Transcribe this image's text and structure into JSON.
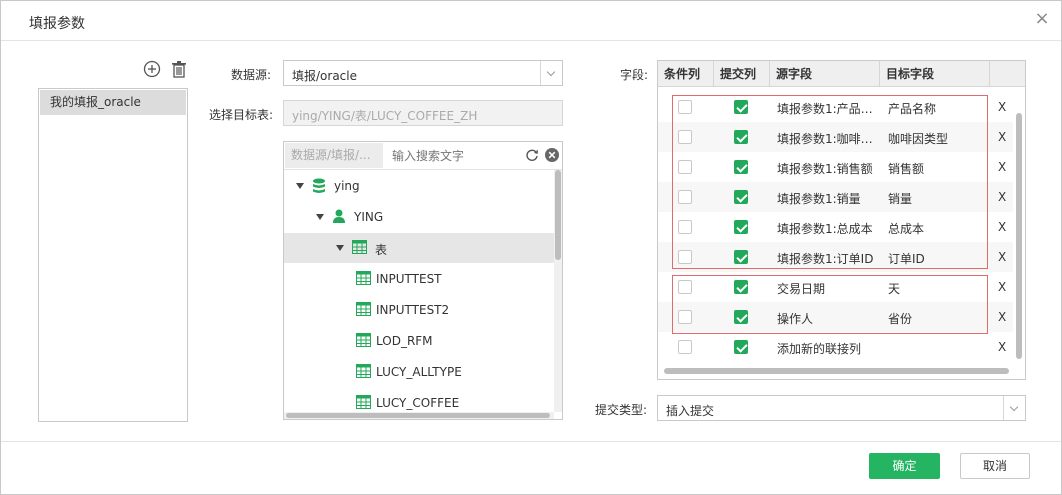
{
  "dialog": {
    "title": "填报参数",
    "close_label": "×"
  },
  "left": {
    "items": [
      {
        "label": "我的填报_oracle"
      }
    ]
  },
  "form": {
    "datasource_label": "数据源:",
    "datasource_value": "填报/oracle",
    "target_label": "选择目标表:",
    "target_value": "ying/YING/表/LUCY_COFFEE_ZH",
    "source_chip": "数据源/填报/...",
    "search_placeholder": "输入搜索文字"
  },
  "tree": {
    "nodes": [
      {
        "label": "ying",
        "icon": "database-icon"
      },
      {
        "label": "YING",
        "icon": "user-icon"
      },
      {
        "label": "表",
        "icon": "table-icon"
      },
      {
        "label": "INPUTTEST",
        "icon": "table-icon"
      },
      {
        "label": "INPUTTEST2",
        "icon": "table-icon"
      },
      {
        "label": "LOD_RFM",
        "icon": "table-icon"
      },
      {
        "label": "LUCY_ALLTYPE",
        "icon": "table-icon"
      },
      {
        "label": "LUCY_COFFEE",
        "icon": "table-icon"
      }
    ]
  },
  "fields": {
    "label": "字段:",
    "columns": [
      "条件列",
      "提交列",
      "源字段",
      "目标字段"
    ],
    "rows": [
      {
        "condition": false,
        "submit": true,
        "source": "填报参数1:产品…",
        "target": "产品名称",
        "remove": "X"
      },
      {
        "condition": false,
        "submit": true,
        "source": "填报参数1:咖啡…",
        "target": "咖啡因类型",
        "remove": "X"
      },
      {
        "condition": false,
        "submit": true,
        "source": "填报参数1:销售额",
        "target": "销售额",
        "remove": "X"
      },
      {
        "condition": false,
        "submit": true,
        "source": "填报参数1:销量",
        "target": "销量",
        "remove": "X"
      },
      {
        "condition": false,
        "submit": true,
        "source": "填报参数1:总成本",
        "target": "总成本",
        "remove": "X"
      },
      {
        "condition": false,
        "submit": true,
        "source": "填报参数1:订单ID",
        "target": "订单ID",
        "remove": "X"
      },
      {
        "condition": false,
        "submit": true,
        "source": "交易日期",
        "target": "天",
        "remove": "X"
      },
      {
        "condition": false,
        "submit": true,
        "source": "操作人",
        "target": "省份",
        "remove": "X"
      },
      {
        "condition": false,
        "submit": true,
        "source": "添加新的联接列",
        "target": "",
        "remove": "X"
      }
    ]
  },
  "submit_type": {
    "label": "提交类型:",
    "value": "插入提交"
  },
  "buttons": {
    "ok": "确定",
    "cancel": "取消"
  },
  "colors": {
    "accent": "#25b462",
    "highlight_border": "#e06b6b"
  }
}
